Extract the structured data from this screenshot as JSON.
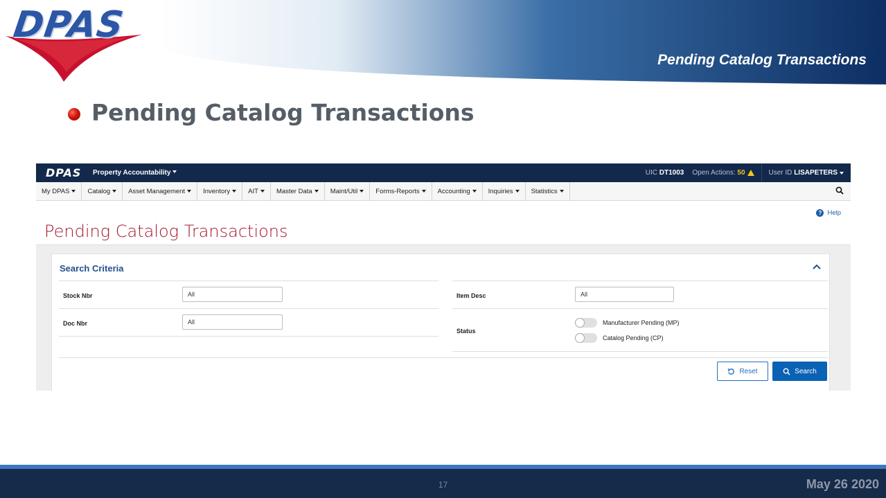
{
  "slide": {
    "logo": "DPAS",
    "header_title": "Pending Catalog Transactions",
    "bullet": "Pending Catalog Transactions",
    "page_number": "17",
    "date": "May 26 2020"
  },
  "app": {
    "topbar": {
      "logo": "DPAS",
      "module": "Property Accountability",
      "uic_label": "UIC",
      "uic_value": "DT1003",
      "open_actions_label": "Open Actions:",
      "open_actions_value": "50",
      "user_label": "User ID",
      "user_value": "LISAPETERS"
    },
    "nav": [
      "My DPAS",
      "Catalog",
      "Asset Management",
      "Inventory",
      "AIT",
      "Master Data",
      "Maint/Util",
      "Forms-Reports",
      "Accounting",
      "Inquiries",
      "Statistics"
    ],
    "help_label": "Help",
    "page_title": "Pending Catalog Transactions",
    "search": {
      "title": "Search Criteria",
      "stock_nbr_label": "Stock Nbr",
      "stock_nbr_value": "All",
      "doc_nbr_label": "Doc Nbr",
      "doc_nbr_value": "All",
      "item_desc_label": "Item Desc",
      "item_desc_value": "All",
      "status_label": "Status",
      "status_options": [
        {
          "label": "Manufacturer Pending (MP)",
          "on": false
        },
        {
          "label": "Catalog Pending (CP)",
          "on": false
        }
      ],
      "reset_label": "Reset",
      "search_label": "Search"
    }
  },
  "colors": {
    "app_navy": "#13294b",
    "title_red": "#a6192e",
    "primary_blue": "#0a62b5",
    "footer_navy": "#162a4a"
  }
}
